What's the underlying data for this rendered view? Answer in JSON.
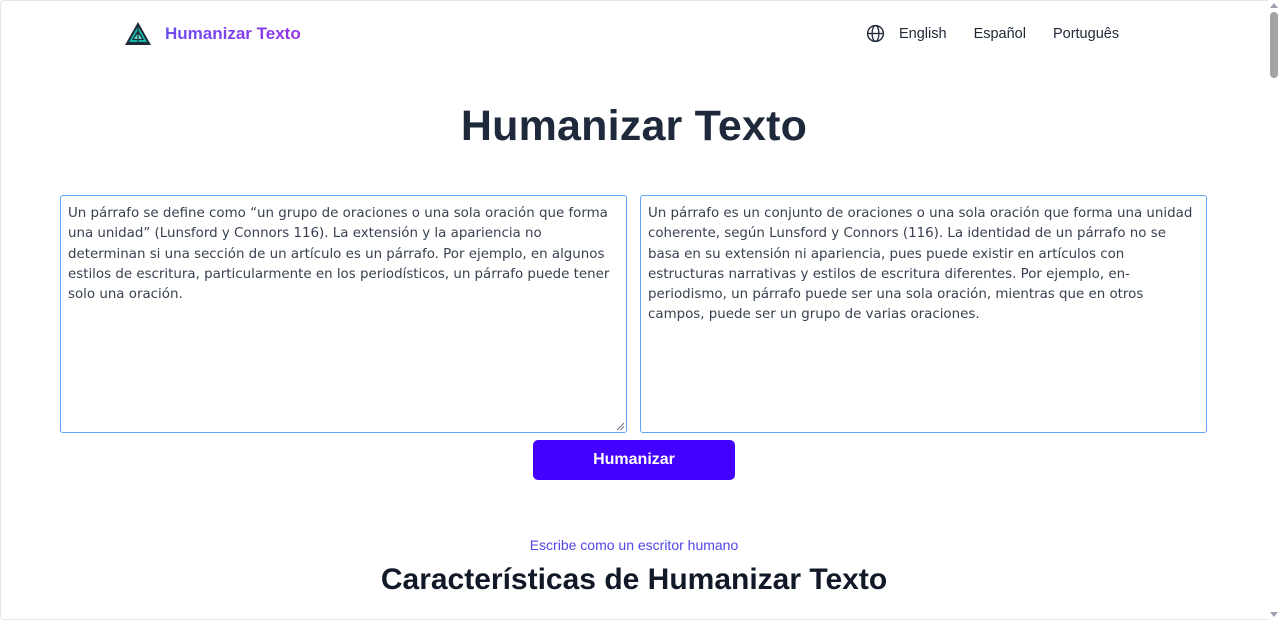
{
  "header": {
    "brand": "Humanizar Texto",
    "logo_icon": "pine-tree-logo-icon",
    "language_icon": "globe-icon",
    "languages": [
      "English",
      "Español",
      "Português"
    ]
  },
  "hero": {
    "title": "Humanizar Texto"
  },
  "editor": {
    "input_text": "Un párrafo se define como “un grupo de oraciones o una sola oración que forma una unidad” (Lunsford y Connors 116). La extensión y la apariencia no determinan si una sección de un artículo es un párrafo. Por ejemplo, en algunos estilos de escritura, particularmente en los periodísticos, un párrafo puede tener solo una oración.",
    "output_text": "Un párrafo es un conjunto de oraciones o una sola oración que forma una unidad coherente, según Lunsford y Connors (116). La identidad de un párrafo no se basa en su extensión ni apariencia, pues puede existir en artículos con estructuras narrativas y estilos de escritura diferentes. Por ejemplo, en-periodismo, un párrafo puede ser una sola oración, mientras que en otros campos, puede ser un grupo de varias oraciones.",
    "button_label": "Humanizar"
  },
  "features": {
    "eyebrow": "Escribe como un escritor humano",
    "title": "Características de Humanizar Texto"
  },
  "colors": {
    "accent": "#4300ff",
    "brand_gradient_start": "#6d4cf0",
    "brand_gradient_end": "#9333ea",
    "field_border": "#60a5fa",
    "eyebrow": "#4f46e5"
  }
}
